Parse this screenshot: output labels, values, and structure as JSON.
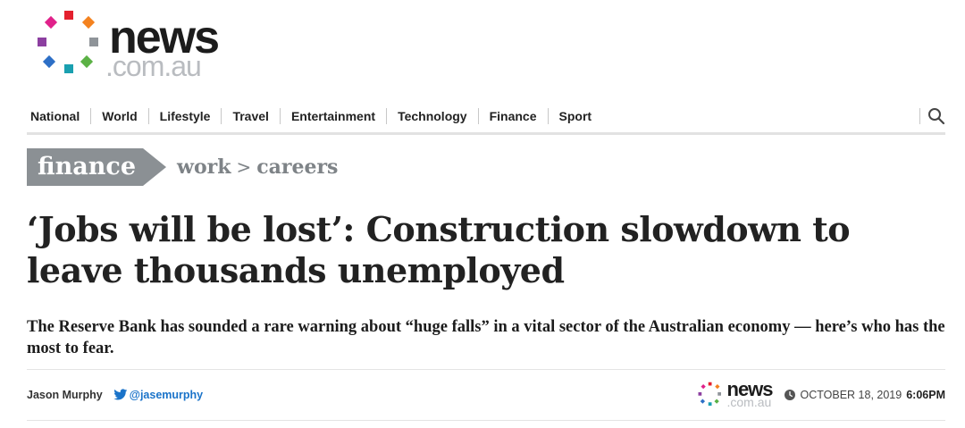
{
  "logo": {
    "wordmark": "news",
    "domain": ".com.au"
  },
  "nav": {
    "items": [
      "National",
      "World",
      "Lifestyle",
      "Travel",
      "Entertainment",
      "Technology",
      "Finance",
      "Sport"
    ]
  },
  "breadcrumb": {
    "section": "finance",
    "level1": "work",
    "level2": "careers"
  },
  "article": {
    "headline": "‘Jobs will be lost’: Construction slowdown to leave thousands unemployed",
    "standfirst": "The Reserve Bank has sounded a rare warning about “huge falls” in a vital sector of the Australian economy — here’s who has the most to fear.",
    "author": "Jason Murphy",
    "twitter_handle": "@jasemurphy",
    "source_logo": {
      "wordmark": "news",
      "domain": ".com.au"
    },
    "date": "OCTOBER 18, 2019",
    "time": "6:06PM"
  },
  "colors": {
    "dot_red": "#e4202e",
    "dot_orange": "#f4821f",
    "dot_magenta": "#e0218a",
    "dot_purple": "#8c3fa0",
    "dot_blue": "#2d6fc6",
    "dot_teal": "#1aa0b0",
    "dot_green": "#5bb145",
    "dot_gray": "#8f9499",
    "breadcrumb_bg": "#8b9094",
    "twitter_blue": "#1a73c9"
  }
}
